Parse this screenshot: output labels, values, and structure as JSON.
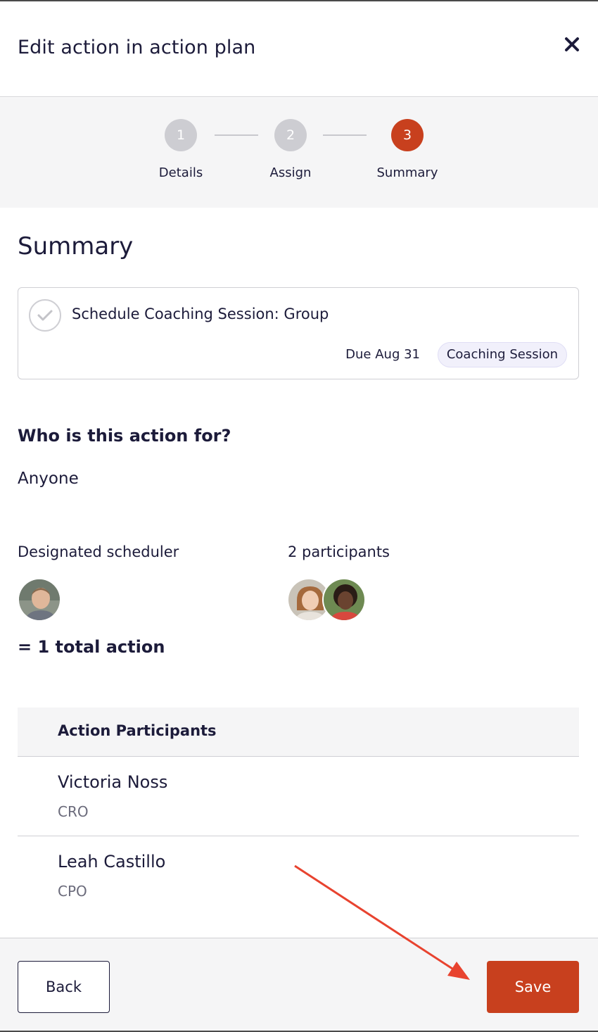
{
  "header": {
    "title": "Edit action in action plan",
    "close_icon": "close-icon"
  },
  "stepper": {
    "steps": [
      {
        "number": "1",
        "label": "Details",
        "state": "inactive"
      },
      {
        "number": "2",
        "label": "Assign",
        "state": "inactive"
      },
      {
        "number": "3",
        "label": "Summary",
        "state": "active"
      }
    ]
  },
  "summary": {
    "title": "Summary",
    "action": {
      "title": "Schedule Coaching Session: Group",
      "due": "Due Aug 31",
      "tag": "Coaching Session"
    }
  },
  "audience": {
    "question": "Who is this action for?",
    "value": "Anyone"
  },
  "assignment": {
    "scheduler_label": "Designated scheduler",
    "participants_label": "2 participants",
    "total": "= 1 total action"
  },
  "participants_table": {
    "header": "Action Participants",
    "rows": [
      {
        "name": "Victoria Noss",
        "role": "CRO"
      },
      {
        "name": "Leah Castillo",
        "role": "CPO"
      }
    ]
  },
  "footer": {
    "back_label": "Back",
    "save_label": "Save"
  },
  "colors": {
    "accent": "#c8401e",
    "text": "#1c1b3a",
    "muted": "#6b6b7b",
    "annotation_arrow": "#e8432f"
  }
}
